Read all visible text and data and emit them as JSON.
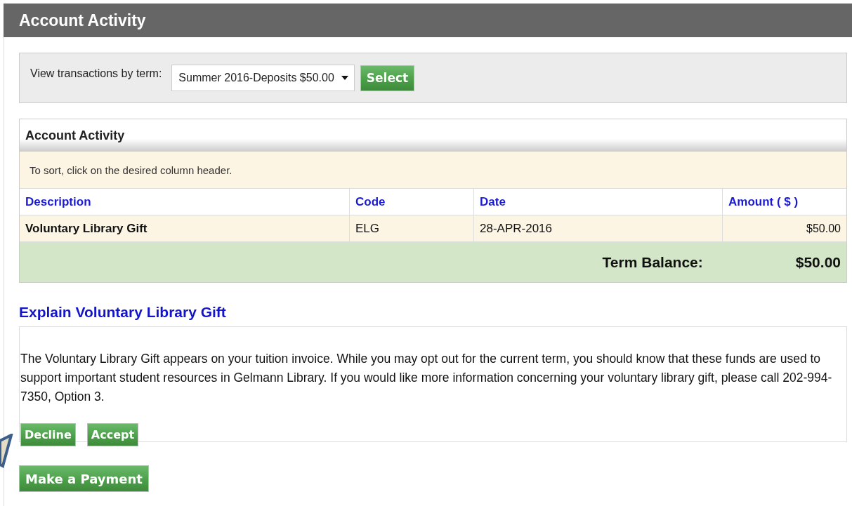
{
  "title": "Account Activity",
  "filter": {
    "label": "View transactions by term:",
    "value": "Summer 2016-Deposits $50.00",
    "button": "Select"
  },
  "activity": {
    "title": "Account Activity",
    "hint": "To sort, click on the desired column header.",
    "columns": [
      "Description",
      "Code",
      "Date",
      "Amount ( $ )"
    ],
    "rows": [
      [
        "Voluntary Library Gift",
        "ELG",
        "28-APR-2016",
        "$50.00"
      ]
    ],
    "balance_label": "Term Balance:",
    "balance": "$50.00"
  },
  "explain": {
    "heading": "Explain Voluntary Library Gift",
    "text": "The Voluntary Library Gift appears on your tuition invoice. While you may opt out for the current term, you should know that these funds are used to support important student resources in Gelmann Library. If you would like more information concerning your voluntary library gift, please call 202-994-7350, Option 3.",
    "buttons": [
      "Decline",
      "Accept"
    ]
  },
  "payment_button": "Make a Payment"
}
